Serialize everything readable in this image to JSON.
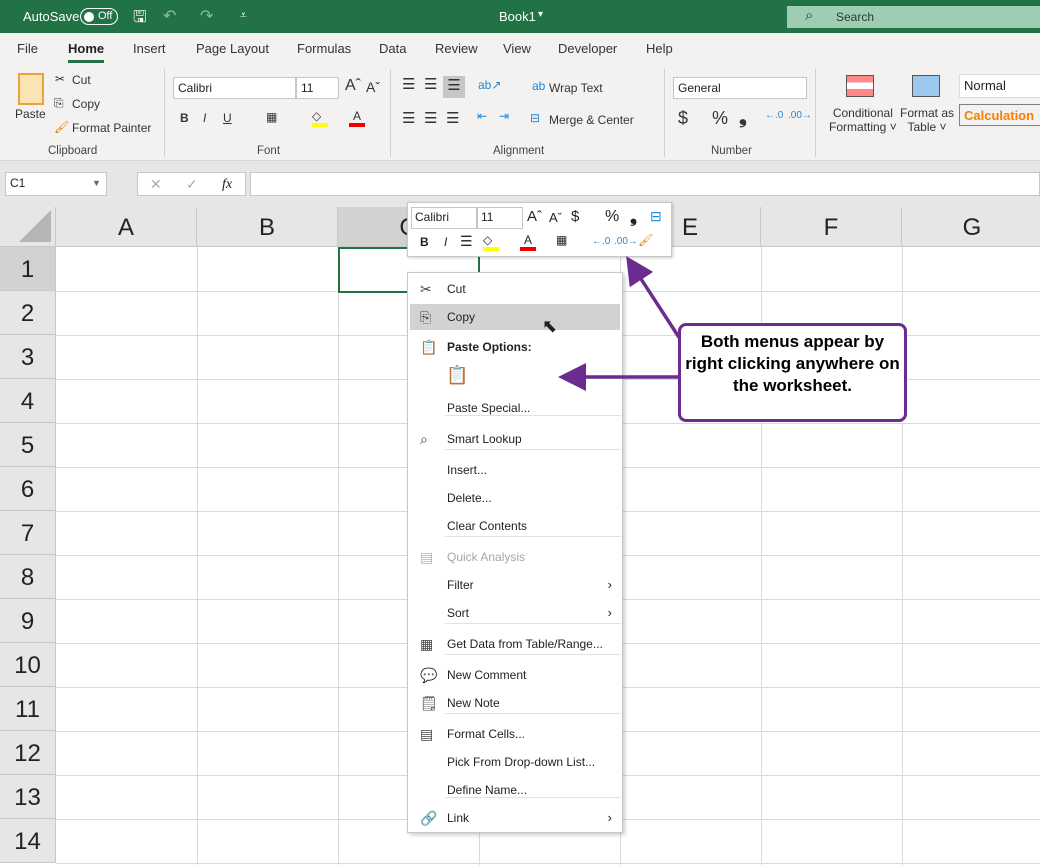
{
  "titlebar": {
    "autosave": "AutoSave",
    "toggle": "Off",
    "book": "Book1",
    "search": "Search",
    "color": "#217346"
  },
  "tabs": [
    "File",
    "Home",
    "Insert",
    "Page Layout",
    "Formulas",
    "Data",
    "Review",
    "View",
    "Developer",
    "Help"
  ],
  "ribbon": {
    "clipboard": {
      "paste": "Paste",
      "cut": "Cut",
      "copy": "Copy",
      "format_painter": "Format Painter",
      "label": "Clipboard"
    },
    "font": {
      "name": "Calibri",
      "size": "11",
      "bold": "B",
      "italic": "I",
      "underline": "U",
      "label": "Font"
    },
    "alignment": {
      "wrap": "Wrap Text",
      "merge": "Merge & Center",
      "label": "Alignment"
    },
    "number": {
      "format": "General",
      "currency": "$",
      "percent": "%",
      "comma": "❟",
      "label": "Number"
    },
    "styles": {
      "conditional": "Conditional",
      "conditional2": "Formatting",
      "format_table": "Format as",
      "format_table2": "Table",
      "normal": "Normal",
      "calculation": "Calculation"
    }
  },
  "formula_bar": {
    "name_box": "C1",
    "fx": "fx",
    "value": ""
  },
  "columns": [
    "A",
    "B",
    "C",
    "D",
    "E",
    "F",
    "G"
  ],
  "rows": [
    "1",
    "2",
    "3",
    "4",
    "5",
    "6",
    "7",
    "8",
    "9",
    "10",
    "11",
    "12",
    "13",
    "14"
  ],
  "mini_toolbar": {
    "font": "Calibri",
    "size": "11",
    "bold": "B",
    "italic": "I",
    "currency": "$",
    "percent": "%"
  },
  "context_menu": [
    {
      "label": "Cut",
      "icon": "scissors-icon"
    },
    {
      "label": "Copy",
      "icon": "copy-icon",
      "highlighted": true
    },
    {
      "label": "Paste Options:",
      "icon": "paste-icon",
      "bold": true
    },
    {
      "label": "Paste Special..."
    },
    {
      "label": "Smart Lookup",
      "icon": "search-icon"
    },
    {
      "label": "Insert..."
    },
    {
      "label": "Delete..."
    },
    {
      "label": "Clear Contents"
    },
    {
      "label": "Quick Analysis",
      "icon": "quick-analysis-icon",
      "disabled": true
    },
    {
      "label": "Filter",
      "submenu": true
    },
    {
      "label": "Sort",
      "submenu": true
    },
    {
      "label": "Get Data from Table/Range...",
      "icon": "table-icon"
    },
    {
      "label": "New Comment",
      "icon": "comment-icon"
    },
    {
      "label": "New Note",
      "icon": "note-icon"
    },
    {
      "label": "Format Cells...",
      "icon": "format-cells-icon"
    },
    {
      "label": "Pick From Drop-down List..."
    },
    {
      "label": "Define Name..."
    },
    {
      "label": "Link",
      "icon": "link-icon",
      "submenu": true
    }
  ],
  "callout": {
    "text": "Both menus appear by right clicking anywhere on the worksheet.",
    "color": "#6a2c8e"
  }
}
